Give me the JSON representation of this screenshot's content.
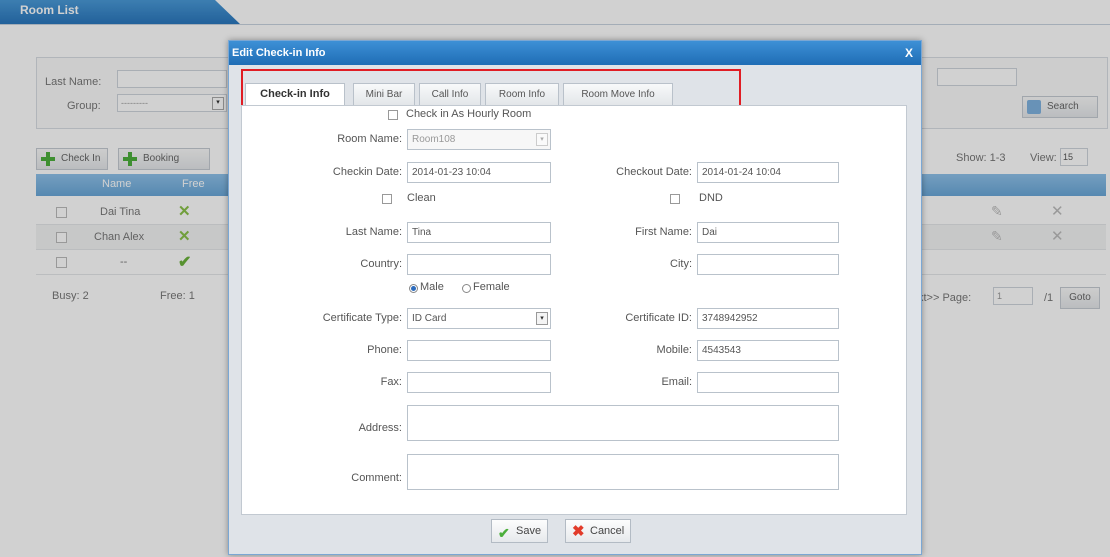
{
  "background": {
    "room_list_tab": "Room List",
    "search": {
      "last_name_label": "Last Name:",
      "group_label": "Group:",
      "group_value": "---------",
      "search_button": "Search"
    },
    "toolbar": {
      "check_in_button": "Check In",
      "booking_button": "Booking",
      "show_text": "Show: 1-3",
      "view_label": "View:",
      "view_value": "15"
    },
    "table": {
      "columns": [
        "Name",
        "Free"
      ],
      "rows": [
        {
          "name": "Dai Tina",
          "free": "no"
        },
        {
          "name": "Chan Alex",
          "free": "no"
        },
        {
          "name": "--",
          "free": "yes"
        }
      ]
    },
    "footer": {
      "busy": "Busy: 2",
      "free": "Free: 1",
      "next_page": "xt>> Page:",
      "page_value": "1",
      "total": "/1",
      "goto": "Goto"
    }
  },
  "dialog": {
    "title": "Edit Check-in Info",
    "close": "X",
    "tabs": [
      "Check-in Info",
      "Mini Bar",
      "Call Info",
      "Room Info",
      "Room Move Info"
    ],
    "active_tab": 0,
    "highlight_color": "#e01d24",
    "form": {
      "hourly_label": "Check in As Hourly Room",
      "room_name_label": "Room Name:",
      "room_name_value": "Room108",
      "checkin_date_label": "Checkin Date:",
      "checkin_date_value": "2014-01-23 10:04",
      "checkout_date_label": "Checkout Date:",
      "checkout_date_value": "2014-01-24 10:04",
      "clean_label": "Clean",
      "dnd_label": "DND",
      "last_name_label": "Last Name:",
      "last_name_value": "Tina",
      "first_name_label": "First Name:",
      "first_name_value": "Dai",
      "country_label": "Country:",
      "country_value": "",
      "city_label": "City:",
      "city_value": "",
      "male_label": "Male",
      "female_label": "Female",
      "gender_selected": "Male",
      "certificate_type_label": "Certificate Type:",
      "certificate_type_value": "ID Card",
      "certificate_id_label": "Certificate ID:",
      "certificate_id_value": "3748942952",
      "phone_label": "Phone:",
      "phone_value": "",
      "mobile_label": "Mobile:",
      "mobile_value": "4543543",
      "fax_label": "Fax:",
      "fax_value": "",
      "email_label": "Email:",
      "email_value": "",
      "address_label": "Address:",
      "address_value": "",
      "comment_label": "Comment:",
      "comment_value": ""
    },
    "buttons": {
      "save": "Save",
      "cancel": "Cancel"
    }
  }
}
